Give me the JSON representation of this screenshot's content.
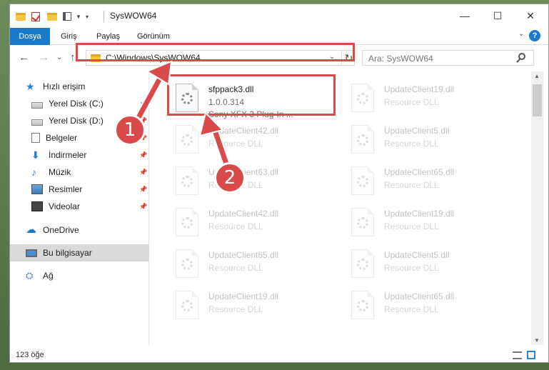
{
  "window": {
    "title": "SysWOW64",
    "controls": {
      "minimize": "—",
      "maximize": "☐",
      "close": "✕"
    }
  },
  "ribbon": {
    "tabs": [
      {
        "label": "Dosya"
      },
      {
        "label": "Giriş"
      },
      {
        "label": "Paylaş"
      },
      {
        "label": "Görünüm"
      }
    ],
    "expand_glyph": "⌄",
    "help_glyph": "?"
  },
  "nav": {
    "back": "←",
    "forward": "→",
    "recent": "⌄",
    "up": "↑",
    "address": "C:\\Windows\\SysWOW64",
    "address_chevron": "⌄",
    "refresh": "↻",
    "search_placeholder": "Ara: SysWOW64"
  },
  "sidebar": {
    "items": [
      {
        "label": "Hızlı erişim",
        "icon": "star-icon",
        "glyph": "★"
      },
      {
        "label": "Yerel Disk (C:)",
        "icon": "disk-icon",
        "pinned": true
      },
      {
        "label": "Yerel Disk (D:)",
        "icon": "disk-icon",
        "pinned": true
      },
      {
        "label": "Belgeler",
        "icon": "document-icon",
        "pinned": true
      },
      {
        "label": "İndirmeler",
        "icon": "download-icon",
        "glyph": "⬇",
        "pinned": true
      },
      {
        "label": "Müzik",
        "icon": "music-icon",
        "glyph": "♪",
        "pinned": true
      },
      {
        "label": "Resimler",
        "icon": "pictures-icon",
        "pinned": true
      },
      {
        "label": "Videolar",
        "icon": "video-icon",
        "pinned": true
      },
      {
        "label": "OneDrive",
        "icon": "cloud-icon",
        "glyph": "☁"
      },
      {
        "label": "Bu bilgisayar",
        "icon": "computer-icon",
        "selected": true
      },
      {
        "label": "Ağ",
        "icon": "network-icon",
        "glyph": "⛭"
      }
    ],
    "pin_glyph": "📌"
  },
  "files": {
    "highlighted": {
      "name": "sfppack3.dll",
      "version": "1.0.0.314",
      "description": "Sony XFX 3 Plug-In ..."
    },
    "column1": [
      {
        "name": "UpdateClient42.dll",
        "type": "Resource DLL"
      },
      {
        "name": "UpdateClient63.dll",
        "type": "Resource DLL"
      },
      {
        "name": "UpdateClient42.dll",
        "type": "Resource DLL"
      },
      {
        "name": "UpdateClient65.dll",
        "type": "Resource DLL"
      },
      {
        "name": "UpdateClient19.dll",
        "type": "Resource DLL"
      }
    ],
    "column2": [
      {
        "name": "UpdateClient19.dll",
        "type": "Resource DLL"
      },
      {
        "name": "UpdateClient5.dll",
        "type": "Resource DLL"
      },
      {
        "name": "UpdateClient65.dll",
        "type": "Resource DLL"
      },
      {
        "name": "UpdateClient19.dll",
        "type": "Resource DLL"
      },
      {
        "name": "UpdateClient5.dll",
        "type": "Resource DLL"
      },
      {
        "name": "UpdateClient65.dll",
        "type": "Resource DLL"
      }
    ]
  },
  "status": {
    "item_count": "123 öğe"
  },
  "annotations": {
    "step1": "1",
    "step2": "2"
  },
  "colors": {
    "accent": "#1979ca",
    "annotation": "#d94a4a"
  }
}
